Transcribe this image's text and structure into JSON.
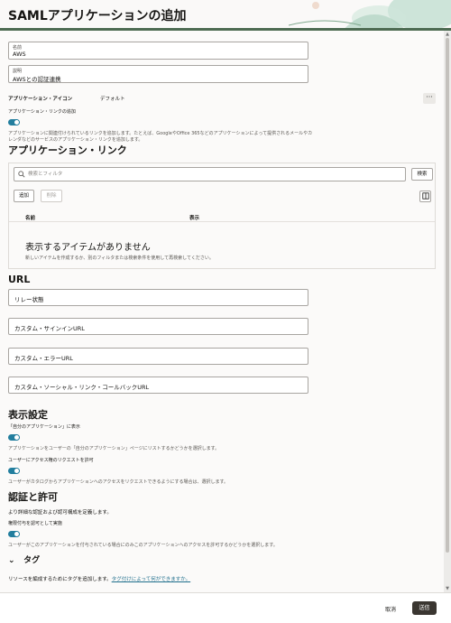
{
  "header": {
    "title": "SAMLアプリケーションの追加"
  },
  "fields": {
    "name": {
      "label": "名前",
      "value": "AWS"
    },
    "description": {
      "label": "説明",
      "value": "AWSとの認証連携"
    }
  },
  "app_icon": {
    "label": "アプリケーション・アイコン",
    "value": "デフォルト",
    "more": "···"
  },
  "app_links_toggle": {
    "label": "アプリケーション・リンクの追加",
    "help_line1": "アプリケーションに関連付けられているリンクを追加します。たとえば、GoogleやOffice 365などのアプリケーションによって提供されるメールやカ",
    "help_line2": "レンダなどのサービスのアプリケーション・リンクを追加します。"
  },
  "app_links": {
    "heading": "アプリケーション・リンク",
    "search_placeholder": "検索とフィルタ",
    "search_button": "検索",
    "add_button": "追加",
    "delete_button": "削除",
    "columns": [
      "名前",
      "表示"
    ],
    "empty_title": "表示するアイテムがありません",
    "empty_sub": "新しいアイテムを作成するか、別のフィルタまたは検索条件を使用して再検索してください。"
  },
  "url": {
    "heading": "URL",
    "relay_state": "リレー状態",
    "custom_signin": "カスタム・サインインURL",
    "custom_error": "カスタム・エラーURL",
    "custom_social": "カスタム・ソーシャル・リンク・コールバックURL"
  },
  "display": {
    "heading": "表示設定",
    "my_apps_label": "「自分のアプリケーション」に表示",
    "my_apps_help": "アプリケーションをユーザーの「自分のアプリケーション」ページにリストするかどうかを選択します。",
    "access_request_label": "ユーザーにアクセス権のリクエストを許可",
    "access_request_help": "ユーザーがカタログからアプリケーションへのアクセスをリクエストできるようにする場合は、選択します。"
  },
  "auth": {
    "heading": "認証と許可",
    "desc": "より詳細な認証および認可構成を定義します。",
    "enforce_label": "権限付与を認可として実施",
    "enforce_help": "ユーザーがこのアプリケーションを付与されている場合にのみこのアプリケーションへのアクセスを許可するかどうかを選択します。"
  },
  "tags": {
    "heading": "タグ",
    "text": "リソースを編成するためにタグを追加します。",
    "link": "タグ付けによって何ができますか。"
  },
  "footer": {
    "cancel": "取消",
    "submit": "送信"
  },
  "colors": {
    "accent": "#227e9e",
    "primary_button": "#3a3631",
    "link": "#1f6e8c"
  }
}
